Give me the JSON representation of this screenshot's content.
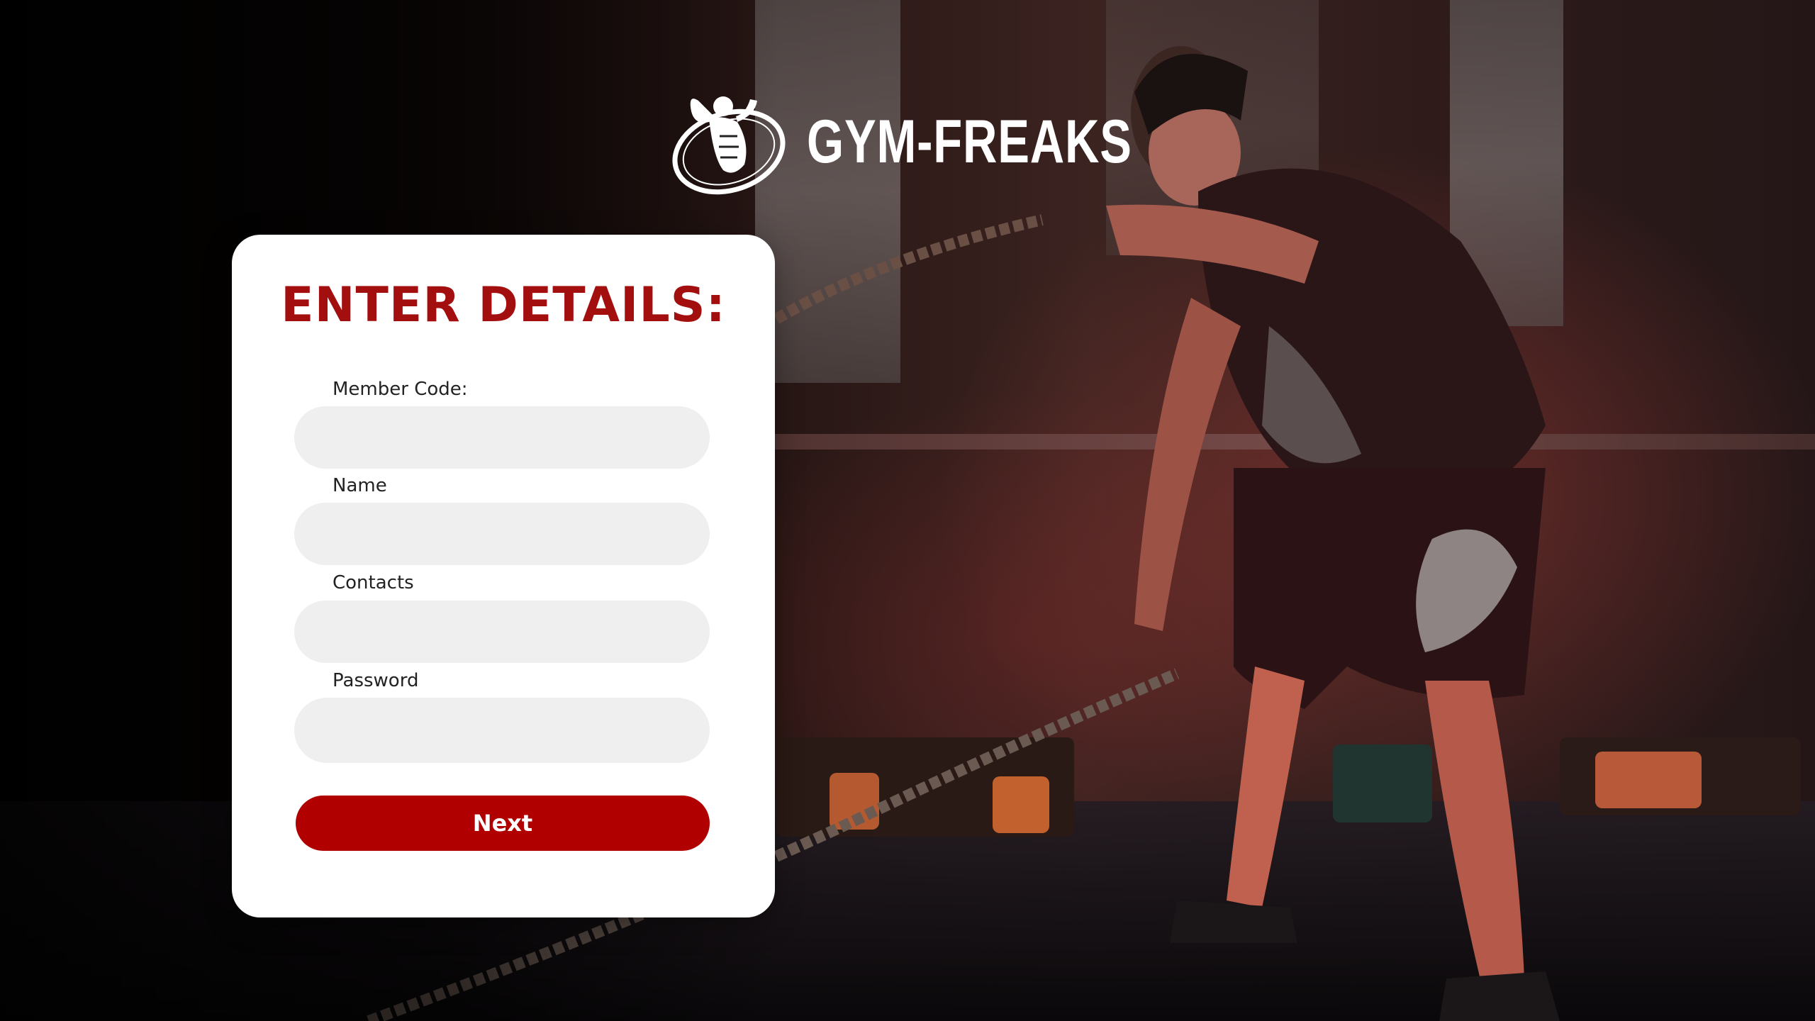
{
  "brand": {
    "name": "GYM-FREAKS",
    "logo_icon": "bodybuilder-flex-icon"
  },
  "form": {
    "title": "ENTER DETAILS:",
    "fields": [
      {
        "label": "Member Code:",
        "value": "",
        "placeholder": ""
      },
      {
        "label": "Name",
        "value": "",
        "placeholder": ""
      },
      {
        "label": "Contacts",
        "value": "",
        "placeholder": ""
      },
      {
        "label": "Password",
        "value": "",
        "placeholder": ""
      }
    ],
    "submit_label": "Next"
  },
  "colors": {
    "accent": "#b00000",
    "title": "#a30e0e",
    "input_bg": "#efefef",
    "card_bg": "#ffffff"
  }
}
